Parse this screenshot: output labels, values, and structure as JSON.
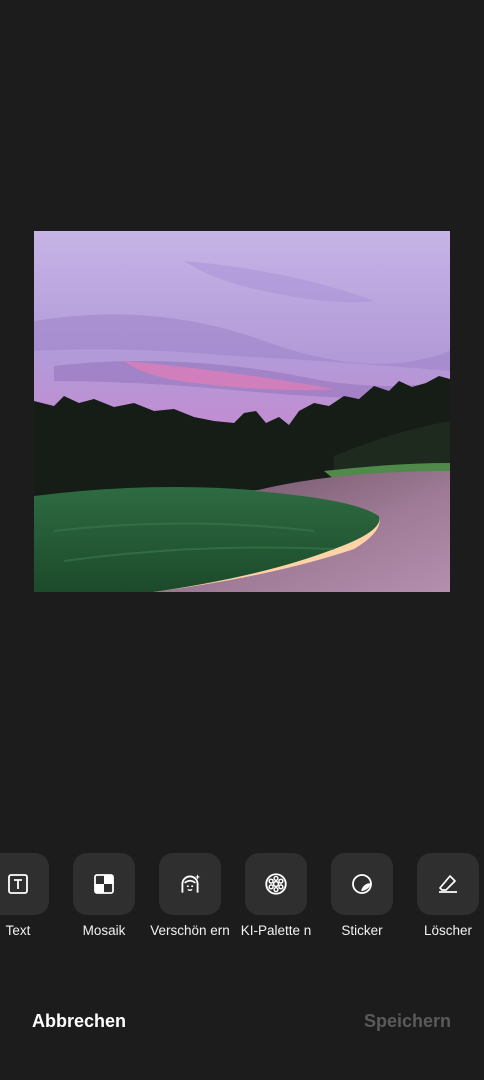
{
  "tools": [
    {
      "id": "text",
      "label": "Text",
      "icon": "text-icon"
    },
    {
      "id": "mosaic",
      "label": "Mosaik",
      "icon": "mosaic-icon"
    },
    {
      "id": "beautify",
      "label": "Verschön ern",
      "icon": "face-beautify-icon"
    },
    {
      "id": "ai-palette",
      "label": "KI-Palette n",
      "icon": "palette-wheel-icon"
    },
    {
      "id": "sticker",
      "label": "Sticker",
      "icon": "sticker-icon"
    },
    {
      "id": "eraser",
      "label": "Löscher",
      "icon": "eraser-icon"
    }
  ],
  "bottom": {
    "cancel_label": "Abbrechen",
    "save_label": "Speichern"
  },
  "colors": {
    "background": "#1c1c1c",
    "tile": "#2f2f2f",
    "save_disabled": "#5a5a5a"
  }
}
